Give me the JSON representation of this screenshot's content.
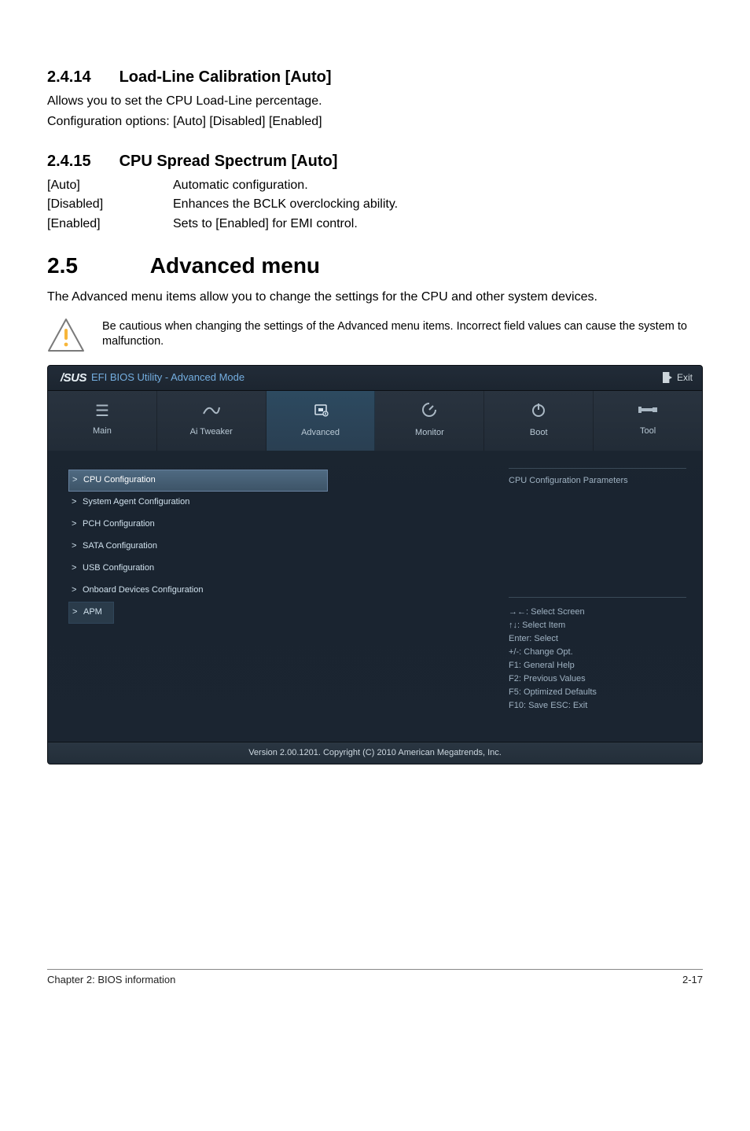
{
  "sections": {
    "s2414": {
      "num": "2.4.14",
      "title": "Load-Line Calibration [Auto]",
      "body1": "Allows you to set the CPU Load-Line percentage.",
      "body2": "Configuration options: [Auto] [Disabled] [Enabled]"
    },
    "s2415": {
      "num": "2.4.15",
      "title": "CPU Spread Spectrum [Auto]",
      "options": [
        {
          "key": "[Auto]",
          "val": "Automatic configuration."
        },
        {
          "key": "[Disabled]",
          "val": "Enhances the BCLK overclocking ability."
        },
        {
          "key": "[Enabled]",
          "val": "Sets to [Enabled] for EMI control."
        }
      ]
    },
    "s25": {
      "num": "2.5",
      "title": "Advanced menu",
      "body": "The Advanced menu items allow you to change the settings for the CPU and other system devices."
    }
  },
  "warning": "Be cautious when changing the settings of the Advanced menu items. Incorrect field values can cause the system to malfunction.",
  "bios": {
    "brand": "/SUS",
    "header_title": "EFI BIOS Utility - Advanced Mode",
    "exit": "Exit",
    "tabs": [
      {
        "label": "Main"
      },
      {
        "label": "Ai Tweaker"
      },
      {
        "label": "Advanced"
      },
      {
        "label": "Monitor"
      },
      {
        "label": "Boot"
      },
      {
        "label": "Tool"
      }
    ],
    "menu": [
      "CPU Configuration",
      "System Agent Configuration",
      "PCH Configuration",
      "SATA Configuration",
      "USB Configuration",
      "Onboard Devices Configuration",
      "APM"
    ],
    "info_title": "CPU Configuration Parameters",
    "help": [
      "→←:  Select Screen",
      "↑↓:  Select Item",
      "Enter:  Select",
      "+/-:  Change Opt.",
      "F1:  General Help",
      "F2:  Previous Values",
      "F5:  Optimized Defaults",
      "F10:  Save   ESC:  Exit"
    ],
    "footer": "Version  2.00.1201.   Copyright  (C)  2010  American  Megatrends,  Inc."
  },
  "page_footer": {
    "left": "Chapter 2: BIOS information",
    "right": "2-17"
  }
}
